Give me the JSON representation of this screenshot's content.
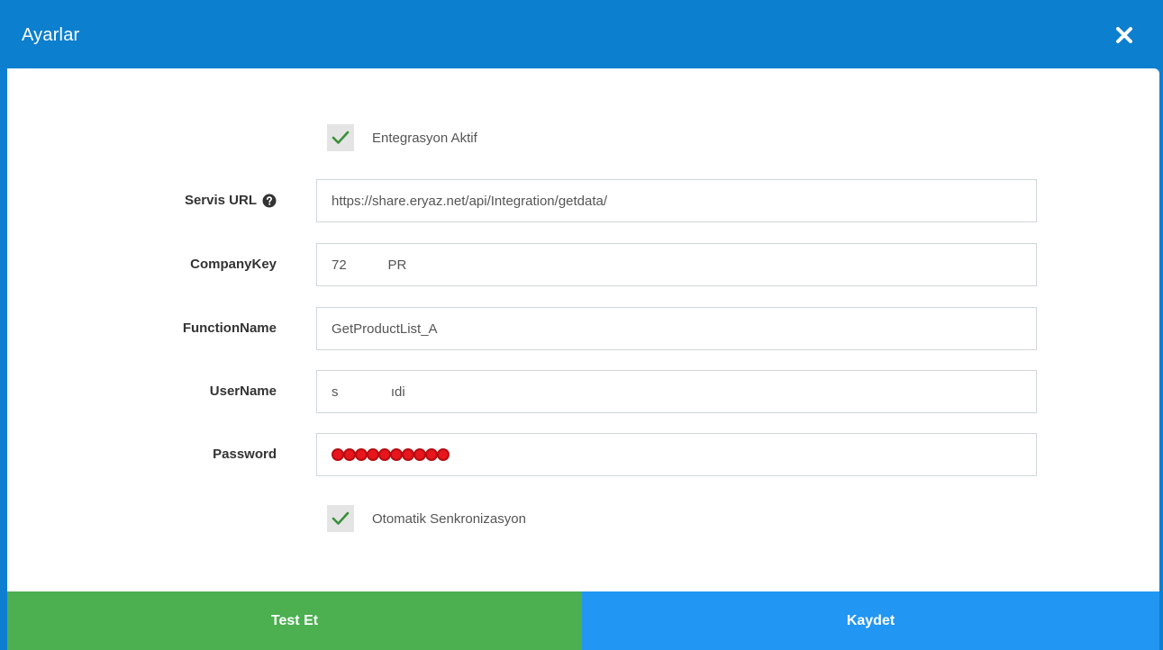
{
  "modal": {
    "title": "Ayarlar"
  },
  "integration_active": {
    "label": "Entegrasyon Aktif",
    "checked": true
  },
  "fields": {
    "service_url": {
      "label": "Servis URL",
      "value": "https://share.eryaz.net/api/Integration/getdata/"
    },
    "company_key": {
      "label": "CompanyKey",
      "value": "72           PR"
    },
    "function_name": {
      "label": "FunctionName",
      "value": "GetProductList_A"
    },
    "user_name": {
      "label": "UserName",
      "value": "s              ıdi"
    },
    "password": {
      "label": "Password",
      "masked_length": 10
    }
  },
  "auto_sync": {
    "label": "Otomatik Senkronizasyon",
    "checked": true
  },
  "buttons": {
    "test": "Test Et",
    "save": "Kaydet"
  },
  "colors": {
    "header": "#0c7fce",
    "check": "#3a8f3a",
    "test_button": "#4caf50",
    "save_button": "#2196f3",
    "password_dot": "#e8161c"
  },
  "icons": {
    "close": "close-icon",
    "help": "question-circle-icon",
    "check": "checkmark-icon"
  }
}
